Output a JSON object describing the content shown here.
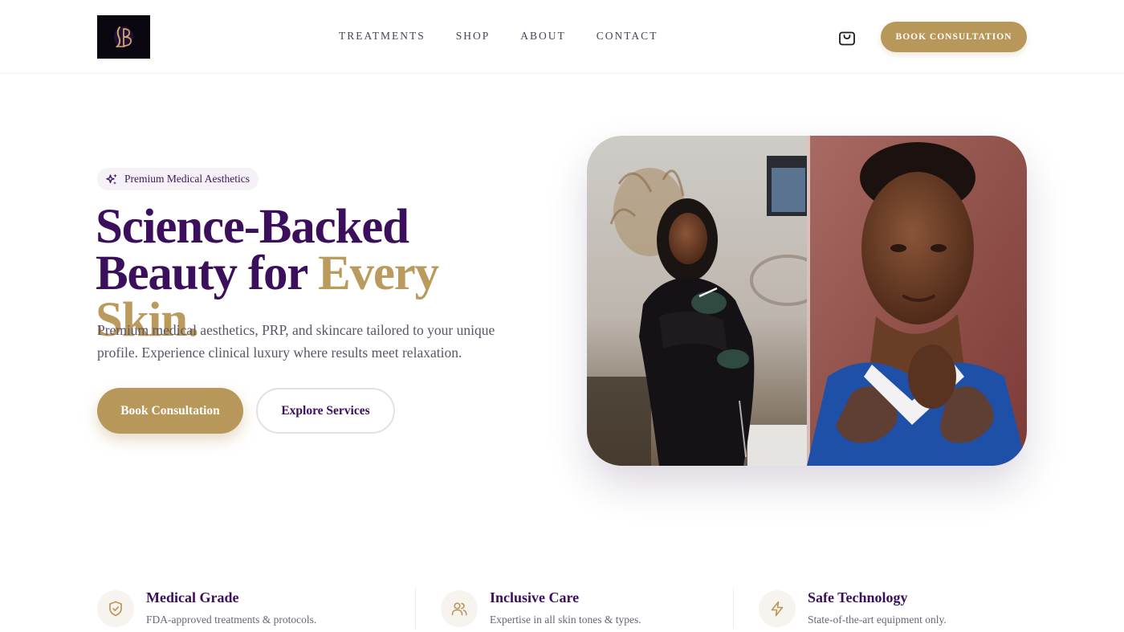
{
  "brand": {
    "logo_monogram": "LB"
  },
  "nav": {
    "items": [
      {
        "label": "TREATMENTS"
      },
      {
        "label": "SHOP"
      },
      {
        "label": "ABOUT"
      },
      {
        "label": "CONTACT"
      }
    ],
    "cta_label": "BOOK CONSULTATION"
  },
  "hero": {
    "badge": "Premium Medical Aesthetics",
    "headline_line1": "Science-Backed",
    "headline_line2_plain": "Beauty for ",
    "headline_line2_accent": "Every Skin.",
    "subtitle": "Premium medical aesthetics, PRP, and skincare tailored to your unique profile. Experience clinical luxury where results meet relaxation.",
    "primary_cta": "Book Consultation",
    "secondary_cta": "Explore Services"
  },
  "features": [
    {
      "title": "Medical Grade",
      "description": "FDA-approved treatments & protocols.",
      "icon": "shield-check-icon"
    },
    {
      "title": "Inclusive Care",
      "description": "Expertise in all skin tones & types.",
      "icon": "users-icon"
    },
    {
      "title": "Safe Technology",
      "description": "State-of-the-art equipment only.",
      "icon": "lightning-icon"
    }
  ],
  "colors": {
    "brand_purple": "#3b0f5c",
    "brand_gold": "#b8975a",
    "text_muted": "#5a5468",
    "badge_bg": "#f5f1f6"
  }
}
